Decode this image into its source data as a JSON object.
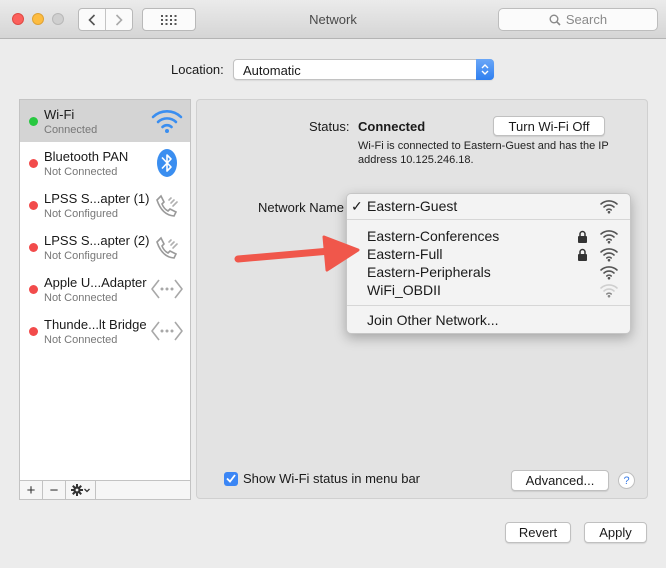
{
  "window": {
    "title": "Network"
  },
  "toolbar": {
    "search_placeholder": "Search"
  },
  "location": {
    "label": "Location:",
    "value": "Automatic"
  },
  "services": [
    {
      "name": "Wi-Fi",
      "status": "Connected",
      "color": "#28c840",
      "icon": "wifi-icon"
    },
    {
      "name": "Bluetooth PAN",
      "status": "Not Connected",
      "color": "#f24b4b",
      "icon": "bluetooth-icon"
    },
    {
      "name": "LPSS S...apter (1)",
      "status": "Not Configured",
      "color": "#f24b4b",
      "icon": "phone-icon"
    },
    {
      "name": "LPSS S...apter (2)",
      "status": "Not Configured",
      "color": "#f24b4b",
      "icon": "phone-icon"
    },
    {
      "name": "Apple U...Adapter",
      "status": "Not Connected",
      "color": "#f24b4b",
      "icon": "ethernet-icon"
    },
    {
      "name": "Thunde...lt Bridge",
      "status": "Not Connected",
      "color": "#f24b4b",
      "icon": "ethernet-icon"
    }
  ],
  "sidebar_buttons": {
    "add": "+",
    "remove": "−"
  },
  "status": {
    "label": "Status:",
    "value": "Connected",
    "toggle_button": "Turn Wi-Fi Off",
    "description": "Wi-Fi is connected to Eastern-Guest and has the IP address 10.125.246.18."
  },
  "network_name": {
    "label": "Network Name",
    "selected": "Eastern-Guest",
    "checkmark": "✓",
    "networks": [
      {
        "name": "Eastern-Conferences",
        "locked": true
      },
      {
        "name": "Eastern-Full",
        "locked": true
      },
      {
        "name": "Eastern-Peripherals",
        "locked": false
      },
      {
        "name": "WiFi_OBDII",
        "locked": false
      }
    ],
    "join_other": "Join Other Network..."
  },
  "show_status": {
    "label": "Show Wi-Fi status in menu bar",
    "checked": true
  },
  "buttons": {
    "advanced": "Advanced...",
    "help": "?",
    "revert": "Revert",
    "apply": "Apply"
  },
  "colors": {
    "accent": "#3b86f5",
    "arrow": "#f0574b",
    "connected": "#28c840",
    "disconnected": "#f24b4b"
  }
}
